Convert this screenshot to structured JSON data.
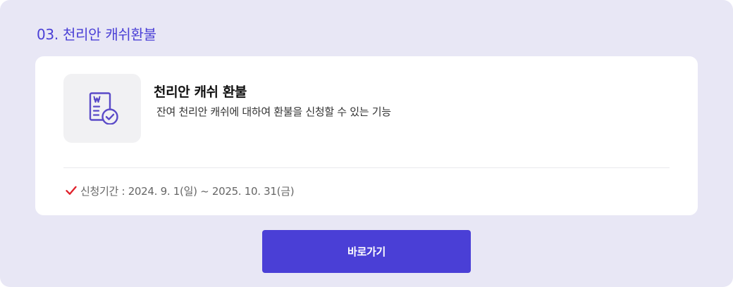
{
  "section": {
    "title": "03. 천리안 캐쉬환불"
  },
  "card": {
    "icon": "document-won-check-icon",
    "title": "천리안 캐쉬 환불",
    "description": "잔여 천리안 캐쉬에 대하여 환불을 신청할 수 있는 기능",
    "period_icon": "checkmark-icon",
    "period_text": "신청기간 : 2024. 9. 1(일) ~ 2025. 10. 31(금)"
  },
  "actions": {
    "go_label": "바로가기"
  },
  "colors": {
    "accent": "#4a3fd6",
    "panel_background": "#e8e7f5",
    "check_red": "#e0202a"
  }
}
